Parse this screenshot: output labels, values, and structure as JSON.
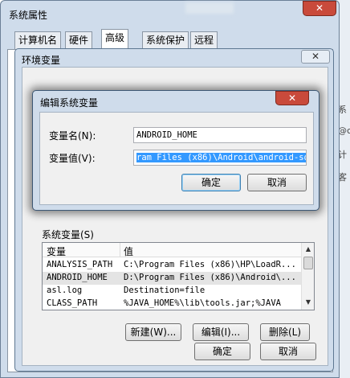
{
  "outer_window": {
    "title": "系统属性",
    "close_glyph": "✕",
    "tabs": [
      "计算机名",
      "硬件",
      "高级",
      "系统保护",
      "远程"
    ],
    "active_tab": "高级"
  },
  "env_window": {
    "title": "环境变量",
    "close_glyph": "✕",
    "system_vars_label": "系统变量(S)",
    "table": {
      "headers": [
        "变量",
        "值"
      ],
      "rows": [
        {
          "name": "ANALYSIS_PATH",
          "value": "C:\\Program Files (x86)\\HP\\LoadR..."
        },
        {
          "name": "ANDROID_HOME",
          "value": "D:\\Program Files (x86)\\Android\\..."
        },
        {
          "name": "asl.log",
          "value": "Destination=file"
        },
        {
          "name": "CLASS_PATH",
          "value": "%JAVA_HOME%\\lib\\tools.jar;%JAVA"
        }
      ],
      "selected_row": 1
    },
    "buttons": {
      "new": "新建(W)...",
      "edit": "编辑(I)...",
      "delete": "删除(L)",
      "ok": "确定",
      "cancel": "取消"
    }
  },
  "edit_dialog": {
    "title": "编辑系统变量",
    "close_glyph": "✕",
    "name_label": "变量名(N):",
    "name_value": "ANDROID_HOME",
    "value_label": "变量值(V):",
    "value_value": "ram Files (x86)\\Android\\android-sdk",
    "ok": "确定",
    "cancel": "取消"
  },
  "background_glyphs": [
    "系",
    "@c",
    "计",
    "客"
  ],
  "colors": {
    "window_frame": "#cfdceb",
    "close_red": "#c94a3b",
    "selection_blue": "#3399ff"
  }
}
